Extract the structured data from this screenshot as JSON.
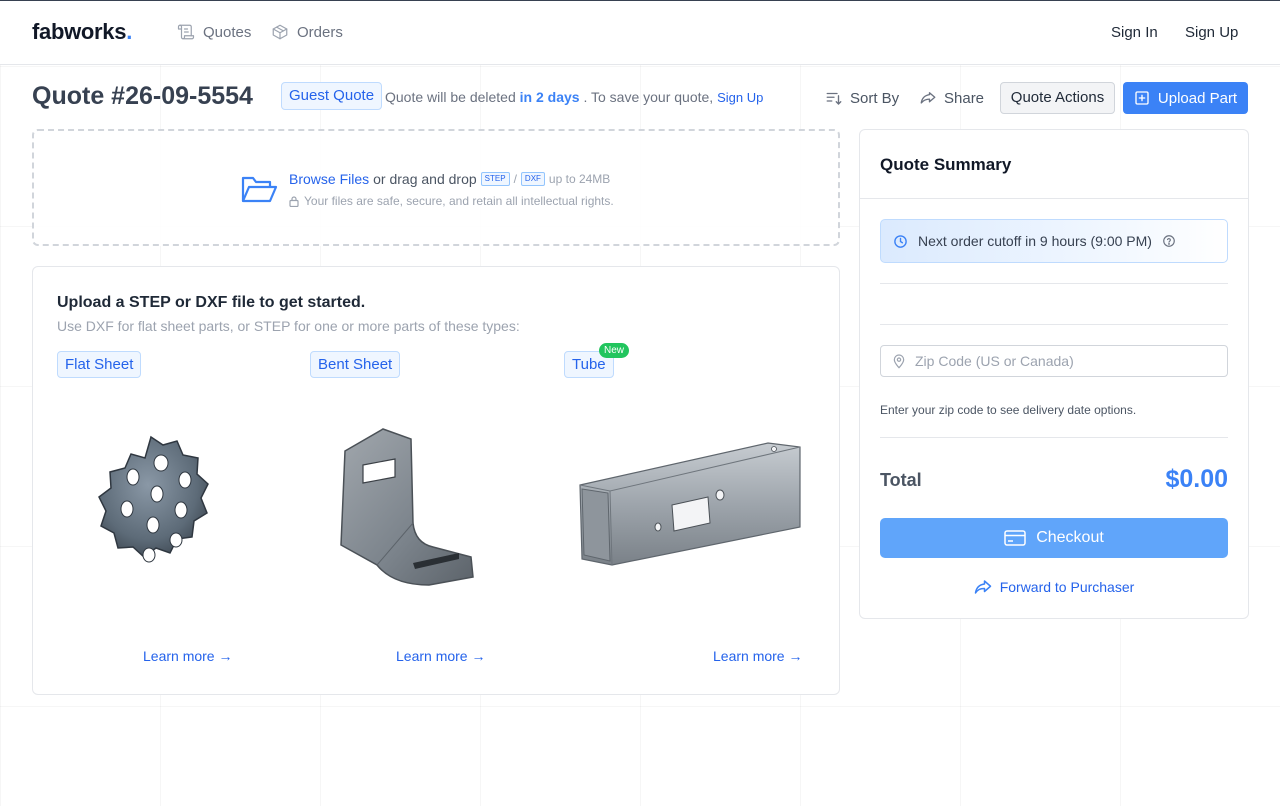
{
  "brand": {
    "name": "fabworks",
    "dot": "."
  },
  "nav": {
    "quotes": "Quotes",
    "orders": "Orders",
    "sign_in": "Sign In",
    "sign_up": "Sign Up"
  },
  "quote": {
    "title": "Quote #26-09-5554",
    "badge": "Guest Quote",
    "note_prefix": "Quote will be deleted",
    "note_days": "in 2 days",
    "note_suffix": ". To save your quote,",
    "note_link": "Sign Up"
  },
  "toolbar": {
    "sort": "Sort By",
    "share": "Share",
    "actions": "Quote Actions",
    "upload": "Upload Part"
  },
  "dropzone": {
    "browse": "Browse Files",
    "drag": "or drag and drop",
    "tag_step": "STEP",
    "sep": "/",
    "tag_dxf": "DXF",
    "limit": "up to 24MB",
    "security": "Your files are safe, secure, and retain all intellectual rights."
  },
  "getting_started": {
    "title": "Upload a STEP or DXF file to get started.",
    "subtitle": "Use DXF for flat sheet parts, or STEP for one or more parts of these types:",
    "types": [
      {
        "label": "Flat Sheet",
        "learn": "Learn more →"
      },
      {
        "label": "Bent Sheet",
        "learn": "Learn more →"
      },
      {
        "label": "Tube",
        "learn": "Learn more →",
        "pill": "New"
      }
    ]
  },
  "summary": {
    "title": "Quote Summary",
    "cutoff": "Next order cutoff in 9 hours (9:00 PM)",
    "zip_placeholder": "Zip Code (US or Canada)",
    "zip_hint": "Enter your zip code to see delivery date options.",
    "total_label": "Total",
    "total_value": "$0.00",
    "checkout": "Checkout",
    "forward": "Forward to Purchaser"
  },
  "colors": {
    "accent": "#3b82f6",
    "new_pill": "#22c55e"
  },
  "icons": [
    "scroll-icon",
    "box-icon",
    "sort-icon",
    "share-icon",
    "plus-square-icon",
    "folder-open-icon",
    "lock-icon",
    "clock-icon",
    "help-circle-icon",
    "map-pin-icon",
    "credit-card-icon",
    "forward-arrow-icon"
  ]
}
